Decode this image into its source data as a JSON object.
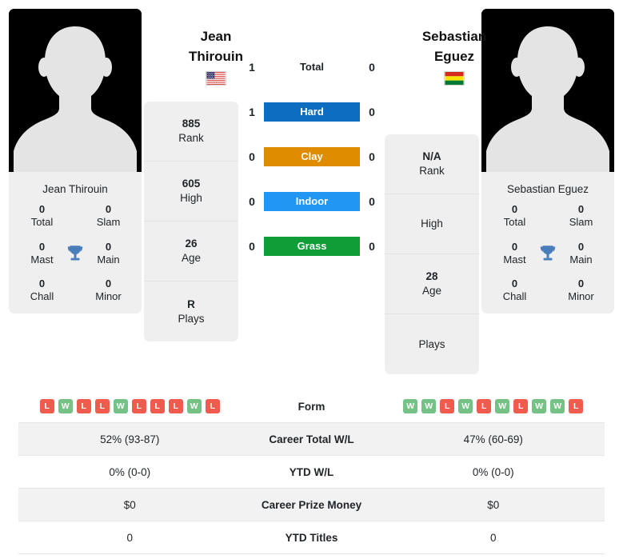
{
  "players": {
    "left": {
      "first_name": "Jean",
      "last_name": "Thirouin",
      "full_name": "Jean Thirouin",
      "flag": "us-flag-icon",
      "flag_alt": "United States flag",
      "stats": [
        {
          "value": "885",
          "label": "Rank"
        },
        {
          "value": "605",
          "label": "High"
        },
        {
          "value": "26",
          "label": "Age"
        },
        {
          "value": "R",
          "label": "Plays"
        }
      ],
      "titles": [
        {
          "value": "0",
          "label": "Total"
        },
        {
          "value": "0",
          "label": "Slam"
        },
        {
          "value": "0",
          "label": "Mast"
        },
        {
          "value": "0",
          "label": "Main"
        },
        {
          "value": "0",
          "label": "Chall"
        },
        {
          "value": "0",
          "label": "Minor"
        }
      ],
      "form": [
        "L",
        "W",
        "L",
        "L",
        "W",
        "L",
        "L",
        "L",
        "W",
        "L"
      ],
      "career_total_wl": "52% (93-87)",
      "ytd_wl": "0% (0-0)",
      "career_prize_money": "$0",
      "ytd_titles": "0"
    },
    "right": {
      "first_name": "Sebastian",
      "last_name": "Eguez",
      "full_name": "Sebastian Eguez",
      "flag": "bolivia-flag-icon",
      "flag_alt": "Bolivia flag",
      "stats": [
        {
          "value": "N/A",
          "label": "Rank"
        },
        {
          "value": "",
          "label": "High"
        },
        {
          "value": "28",
          "label": "Age"
        },
        {
          "value": "",
          "label": "Plays"
        }
      ],
      "titles": [
        {
          "value": "0",
          "label": "Total"
        },
        {
          "value": "0",
          "label": "Slam"
        },
        {
          "value": "0",
          "label": "Mast"
        },
        {
          "value": "0",
          "label": "Main"
        },
        {
          "value": "0",
          "label": "Chall"
        },
        {
          "value": "0",
          "label": "Minor"
        }
      ],
      "form": [
        "W",
        "W",
        "L",
        "W",
        "L",
        "W",
        "L",
        "W",
        "W",
        "L"
      ],
      "career_total_wl": "47% (60-69)",
      "ytd_wl": "0% (0-0)",
      "career_prize_money": "$0",
      "ytd_titles": "0"
    }
  },
  "head_to_head": [
    {
      "surface": "Total",
      "left_score": "1",
      "right_score": "0",
      "color": "transparent"
    },
    {
      "surface": "Hard",
      "left_score": "1",
      "right_score": "0",
      "color": "#0d6ebf"
    },
    {
      "surface": "Clay",
      "left_score": "0",
      "right_score": "0",
      "color": "#e08c00"
    },
    {
      "surface": "Indoor",
      "left_score": "0",
      "right_score": "0",
      "color": "#2196f3"
    },
    {
      "surface": "Grass",
      "left_score": "0",
      "right_score": "0",
      "color": "#0f9d38"
    }
  ],
  "table": {
    "rows": [
      {
        "label": "Form",
        "type": "form",
        "left": "",
        "right": ""
      },
      {
        "label": "Career Total W/L",
        "type": "text",
        "left": "52% (93-87)",
        "right": "47% (60-69)"
      },
      {
        "label": "YTD W/L",
        "type": "text",
        "left": "0% (0-0)",
        "right": "0% (0-0)"
      },
      {
        "label": "Career Prize Money",
        "type": "text",
        "left": "$0",
        "right": "$0"
      },
      {
        "label": "YTD Titles",
        "type": "text",
        "left": "0",
        "right": "0"
      }
    ]
  },
  "colors": {
    "win": "#74c285",
    "loss": "#ef5b4c",
    "hard": "#0d6ebf",
    "clay": "#e08c00",
    "indoor": "#2196f3",
    "grass": "#0f9d38",
    "card_bg": "#efefef",
    "row_alt": "#f2f2f2"
  },
  "icons": {
    "trophy": "trophy-icon",
    "avatar": "person-silhouette-icon"
  }
}
